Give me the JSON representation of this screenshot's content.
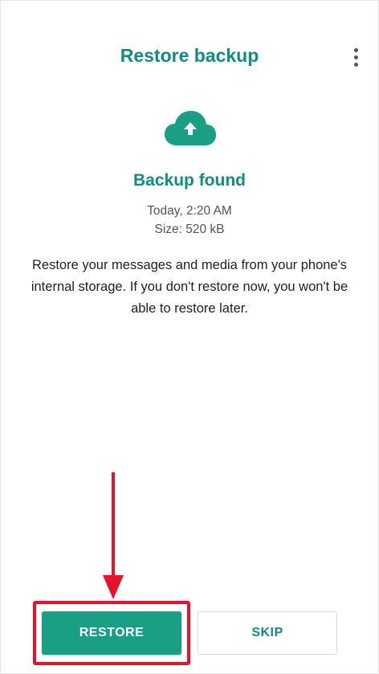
{
  "header": {
    "title": "Restore backup",
    "menu_icon": "more-vert-icon"
  },
  "backup": {
    "icon": "cloud-upload-icon",
    "heading": "Backup found",
    "time": "Today, 2:20 AM",
    "size": "Size: 520 kB"
  },
  "description": "Restore your messages and media from your phone's internal storage. If you don't restore now, you won't be able to restore later.",
  "actions": {
    "restore_label": "RESTORE",
    "skip_label": "SKIP"
  },
  "colors": {
    "brand": "#128C7E",
    "button": "#1a9e84",
    "annotation": "#e5142b"
  }
}
